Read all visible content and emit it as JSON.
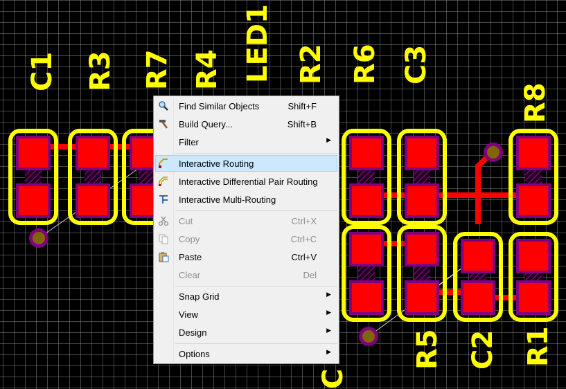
{
  "colors": {
    "background": "#000000",
    "grid": "#ffffff",
    "pad": "#ff0000",
    "solder_mask": "#800080",
    "silkscreen": "#ffff00",
    "track": "#ff0000",
    "via_ring": "#800080",
    "via_hole": "#806600",
    "menu_bg": "#f0f0f0",
    "menu_highlight": "#cce8ff"
  },
  "designators": [
    "C1",
    "R3",
    "R7",
    "R4",
    "LED1",
    "R2",
    "R6",
    "C3",
    "R8",
    "R5",
    "C2",
    "R1",
    "C"
  ],
  "context_menu": {
    "items": [
      {
        "label": "Find Similar Objects",
        "mnemonic": "i",
        "shortcut": "Shift+F",
        "icon": "magnifier-icon",
        "enabled": true,
        "submenu": false
      },
      {
        "label": "Build Query...",
        "mnemonic": "",
        "shortcut": "Shift+B",
        "icon": "hammer-icon",
        "enabled": true,
        "submenu": false
      },
      {
        "label": "Filter",
        "mnemonic": "F",
        "shortcut": "",
        "icon": "",
        "enabled": true,
        "submenu": true,
        "separator_after": true
      },
      {
        "label": "Interactive Routing",
        "mnemonic": "t",
        "shortcut": "",
        "icon": "route-icon",
        "enabled": true,
        "submenu": false,
        "highlighted": true
      },
      {
        "label": "Interactive Differential Pair Routing",
        "mnemonic": "D",
        "shortcut": "",
        "icon": "diff-pair-route-icon",
        "enabled": true,
        "submenu": false
      },
      {
        "label": "Interactive Multi-Routing",
        "mnemonic": "M",
        "shortcut": "",
        "icon": "multi-route-icon",
        "enabled": true,
        "submenu": false,
        "separator_after": true
      },
      {
        "label": "Cut",
        "mnemonic": "t",
        "shortcut": "Ctrl+X",
        "icon": "scissors-icon",
        "enabled": false,
        "submenu": false
      },
      {
        "label": "Copy",
        "mnemonic": "C",
        "shortcut": "Ctrl+C",
        "icon": "copy-icon",
        "enabled": false,
        "submenu": false
      },
      {
        "label": "Paste",
        "mnemonic": "P",
        "shortcut": "Ctrl+V",
        "icon": "paste-icon",
        "enabled": true,
        "submenu": false
      },
      {
        "label": "Clear",
        "mnemonic": "",
        "shortcut": "Del",
        "icon": "",
        "enabled": false,
        "submenu": false,
        "separator_after": true
      },
      {
        "label": "Snap Grid",
        "mnemonic": "G",
        "shortcut": "",
        "icon": "",
        "enabled": true,
        "submenu": true
      },
      {
        "label": "View",
        "mnemonic": "V",
        "shortcut": "",
        "icon": "",
        "enabled": true,
        "submenu": true
      },
      {
        "label": "Design",
        "mnemonic": "D",
        "shortcut": "",
        "icon": "",
        "enabled": true,
        "submenu": true,
        "separator_after": true
      },
      {
        "label": "Options",
        "mnemonic": "O",
        "shortcut": "",
        "icon": "",
        "enabled": true,
        "submenu": true
      }
    ]
  }
}
